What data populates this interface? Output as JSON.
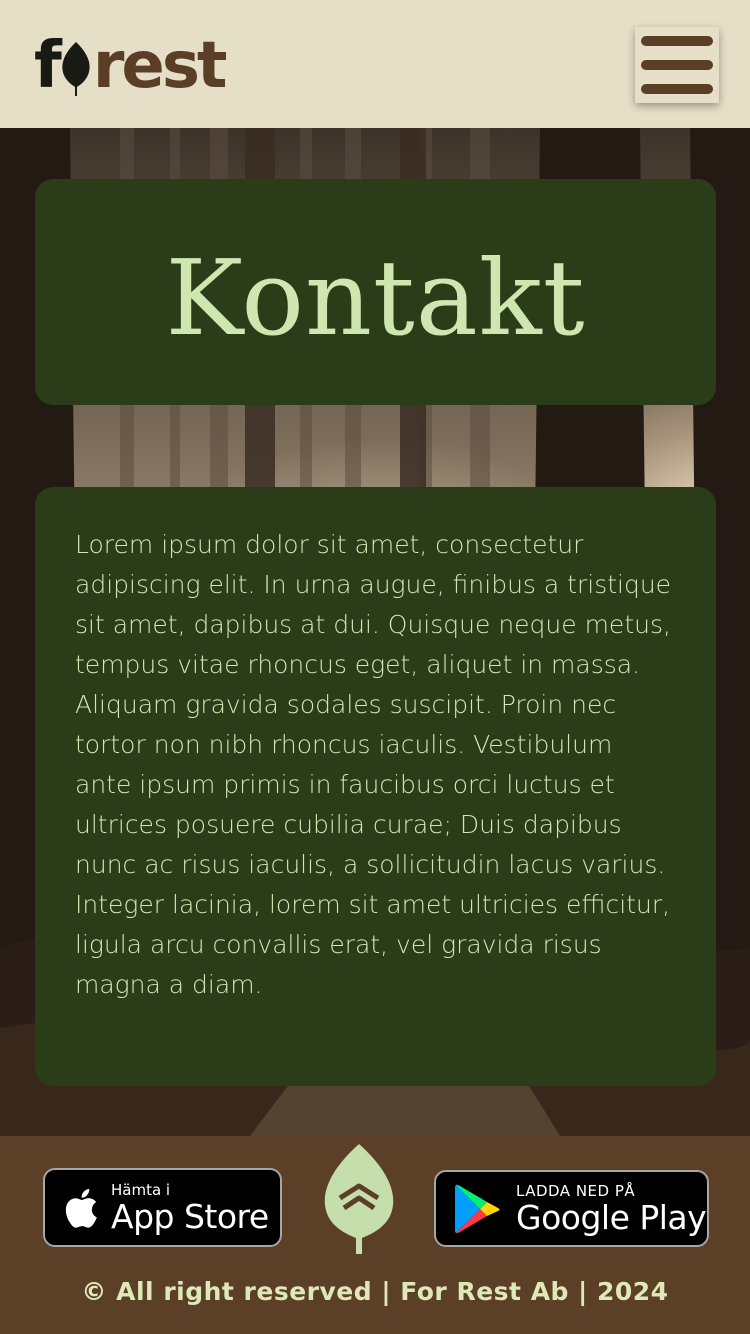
{
  "header": {
    "logo_text_prefix": "f",
    "logo_text_suffix": "rest",
    "menu_icon": "hamburger-menu-icon"
  },
  "main": {
    "title": "Kontakt",
    "body_text": "Lorem ipsum dolor sit amet, consectetur adipiscing elit. In urna augue, finibus a tristique sit amet, dapibus at dui. Quisque neque metus, tempus vitae rhoncus eget, aliquet in massa. Aliquam gravida sodales suscipit. Proin nec tortor non nibh rhoncus iaculis. Vestibulum ante ipsum primis in faucibus orci luctus et ultrices posuere cubilia curae; Duis dapibus nunc ac risus iaculis, a sollicitudin lacus varius. Integer lacinia, lorem sit amet ultricies efficitur, ligula arcu convallis erat, vel gravida risus magna a diam."
  },
  "footer": {
    "app_store": {
      "small": "Hämta i",
      "big": "App Store",
      "icon": "apple-icon"
    },
    "google_play": {
      "small": "LADDA NED PÅ",
      "big": "Google Play",
      "icon": "google-play-icon"
    },
    "center_icon": "leaf-icon",
    "copyright": "© All right reserved | For Rest Ab | 2024"
  },
  "colors": {
    "header_bg": "#e6dfc7",
    "brand_brown": "#5a3e25",
    "card_green": "#2b3d18",
    "text_green": "#d3e6b4",
    "footer_bg": "#5b3f27"
  }
}
